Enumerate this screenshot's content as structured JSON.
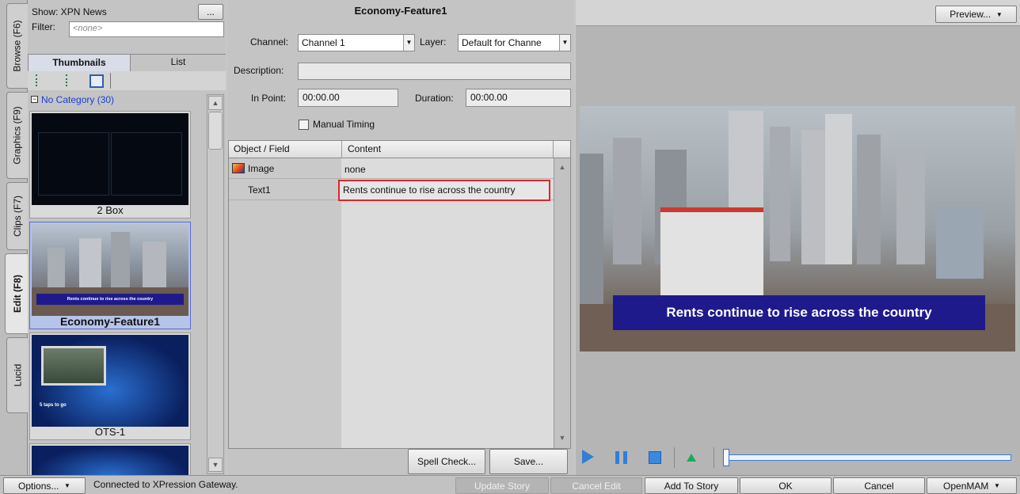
{
  "tabs": [
    {
      "label": "Browse (F6)"
    },
    {
      "label": "Graphics (F9)"
    },
    {
      "label": "Clips (F7)"
    },
    {
      "label": "Edit (F8)"
    },
    {
      "label": "Lucid"
    }
  ],
  "browse": {
    "show_label": "Show: XPN News",
    "more_button": "...",
    "filter_label": "Filter:",
    "filter_placeholder": "<none>",
    "view_tabs": [
      "Thumbnails",
      "List"
    ],
    "category": "No Category (30)",
    "thumbnails": [
      {
        "label": "2 Box"
      },
      {
        "label": "Economy-Feature1",
        "caption": "Rents continue to rise across the country"
      },
      {
        "label": "OTS-1",
        "caption": "5 taps to go"
      }
    ]
  },
  "editor": {
    "title": "Economy-Feature1",
    "channel_label": "Channel:",
    "channel_value": "Channel 1",
    "layer_label": "Layer:",
    "layer_value": "Default for Channe",
    "description_label": "Description:",
    "description_value": "",
    "in_point_label": "In Point:",
    "in_point_value": "00:00.00",
    "duration_label": "Duration:",
    "duration_value": "00:00.00",
    "manual_timing_label": "Manual Timing",
    "table": {
      "headers": [
        "Object / Field",
        "Content"
      ],
      "rows": [
        {
          "field": "Image",
          "content": "none"
        },
        {
          "field": "Text1",
          "content": "Rents continue to rise across the country"
        }
      ]
    },
    "spell_check": "Spell Check...",
    "save": "Save..."
  },
  "preview": {
    "button": "Preview...",
    "lower_third": "Rents continue to rise across the country"
  },
  "statusbar": {
    "options": "Options...",
    "status": "Connected to XPression Gateway.",
    "update_story": "Update Story",
    "cancel_edit": "Cancel Edit",
    "add_to_story": "Add To Story",
    "ok": "OK",
    "cancel": "Cancel",
    "openmam": "OpenMAM"
  },
  "colors": {
    "accent": "#1f1a8c",
    "highlight": "#e0242c",
    "play": "#2f7fd8"
  }
}
